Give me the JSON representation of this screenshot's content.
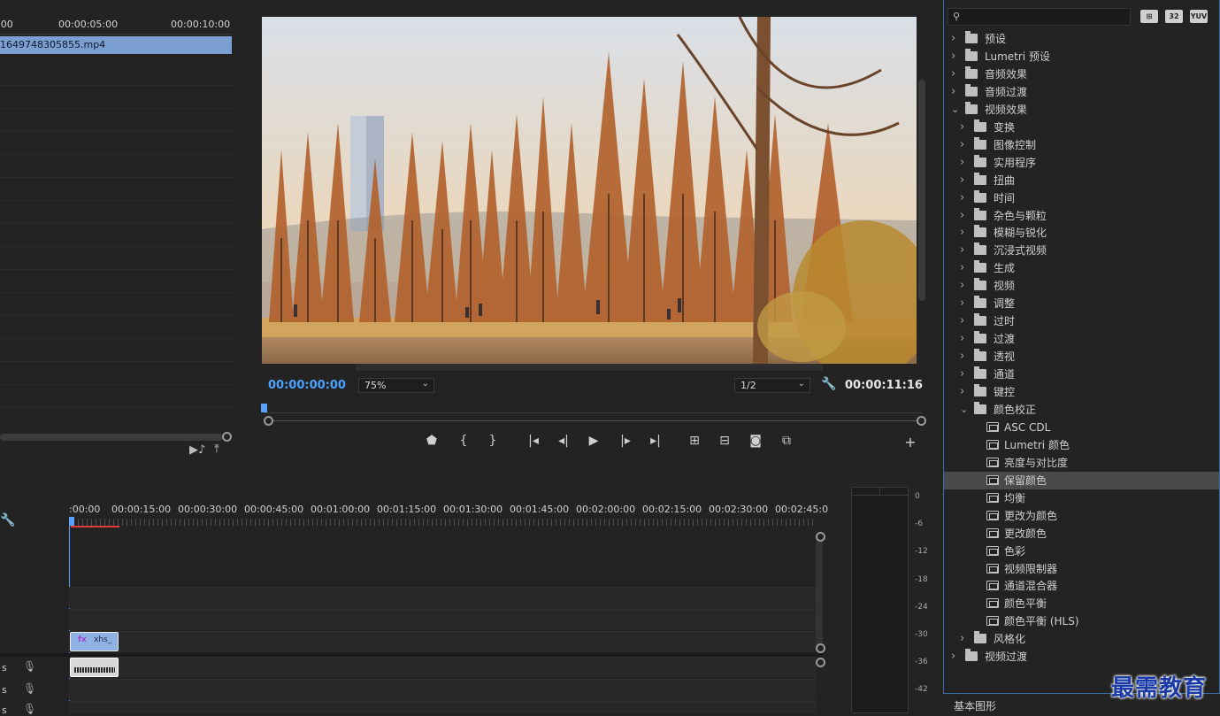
{
  "source": {
    "ruler_labels": [
      ":00",
      "00:00:05:00",
      "00:00:10:00"
    ],
    "clip_name": "1649748305855.mp4"
  },
  "program": {
    "current_time": "00:00:00:00",
    "zoom": "75%",
    "resolution": "1/2",
    "duration": "00:00:11:16",
    "playhead_fraction": 0
  },
  "timeline": {
    "ruler_labels": [
      ":00:00",
      "00:00:15:00",
      "00:00:30:00",
      "00:00:45:00",
      "00:01:00:00",
      "00:01:15:00",
      "00:01:30:00",
      "00:01:45:00",
      "00:02:00:00",
      "00:02:15:00",
      "00:02:30:00",
      "00:02:45:0"
    ],
    "video_clip_label": "xhs_",
    "video_clip_fx": "fx",
    "track_letters": [
      "s",
      "s",
      "s"
    ]
  },
  "meters": {
    "db_labels": [
      "0",
      "-6",
      "-12",
      "-18",
      "-24",
      "-30",
      "-36",
      "-42"
    ]
  },
  "effects": {
    "header_icons": [
      "32",
      "YUV"
    ],
    "items": [
      {
        "label": "预设",
        "level": 0,
        "type": "preset",
        "expanded": false
      },
      {
        "label": "Lumetri 预设",
        "level": 0,
        "type": "preset",
        "expanded": false
      },
      {
        "label": "音频效果",
        "level": 0,
        "type": "folder",
        "expanded": false
      },
      {
        "label": "音频过渡",
        "level": 0,
        "type": "folder",
        "expanded": false
      },
      {
        "label": "视频效果",
        "level": 0,
        "type": "folder",
        "expanded": true
      },
      {
        "label": "变换",
        "level": 1,
        "type": "folder",
        "expanded": false
      },
      {
        "label": "图像控制",
        "level": 1,
        "type": "folder",
        "expanded": false
      },
      {
        "label": "实用程序",
        "level": 1,
        "type": "folder",
        "expanded": false
      },
      {
        "label": "扭曲",
        "level": 1,
        "type": "folder",
        "expanded": false
      },
      {
        "label": "时间",
        "level": 1,
        "type": "folder",
        "expanded": false
      },
      {
        "label": "杂色与颗粒",
        "level": 1,
        "type": "folder",
        "expanded": false
      },
      {
        "label": "模糊与锐化",
        "level": 1,
        "type": "folder",
        "expanded": false
      },
      {
        "label": "沉浸式视频",
        "level": 1,
        "type": "folder",
        "expanded": false
      },
      {
        "label": "生成",
        "level": 1,
        "type": "folder",
        "expanded": false
      },
      {
        "label": "视频",
        "level": 1,
        "type": "folder",
        "expanded": false
      },
      {
        "label": "调整",
        "level": 1,
        "type": "folder",
        "expanded": false
      },
      {
        "label": "过时",
        "level": 1,
        "type": "folder",
        "expanded": false
      },
      {
        "label": "过渡",
        "level": 1,
        "type": "folder",
        "expanded": false
      },
      {
        "label": "透视",
        "level": 1,
        "type": "folder",
        "expanded": false
      },
      {
        "label": "通道",
        "level": 1,
        "type": "folder",
        "expanded": false
      },
      {
        "label": "键控",
        "level": 1,
        "type": "folder",
        "expanded": false
      },
      {
        "label": "颜色校正",
        "level": 1,
        "type": "folder",
        "expanded": true
      },
      {
        "label": "ASC CDL",
        "level": 2,
        "type": "effect"
      },
      {
        "label": "Lumetri 颜色",
        "level": 2,
        "type": "effect"
      },
      {
        "label": "亮度与对比度",
        "level": 2,
        "type": "effect"
      },
      {
        "label": "保留颜色",
        "level": 2,
        "type": "effect",
        "selected": true
      },
      {
        "label": "均衡",
        "level": 2,
        "type": "effect"
      },
      {
        "label": "更改为颜色",
        "level": 2,
        "type": "effect"
      },
      {
        "label": "更改颜色",
        "level": 2,
        "type": "effect"
      },
      {
        "label": "色彩",
        "level": 2,
        "type": "effect"
      },
      {
        "label": "视频限制器",
        "level": 2,
        "type": "effect"
      },
      {
        "label": "通道混合器",
        "level": 2,
        "type": "effect"
      },
      {
        "label": "颜色平衡",
        "level": 2,
        "type": "effect"
      },
      {
        "label": "颜色平衡 (HLS)",
        "level": 2,
        "type": "effect"
      },
      {
        "label": "风格化",
        "level": 1,
        "type": "folder",
        "expanded": false
      },
      {
        "label": "视频过渡",
        "level": 0,
        "type": "folder",
        "expanded": false
      }
    ]
  },
  "bottom_panel_title": "基本图形",
  "watermark": "最需教育",
  "colors": {
    "accent_blue": "#4aa3ff",
    "playhead_blue": "#5aa0ff",
    "clip_blue": "#7a9fd0",
    "work_area_red": "#e23a3a"
  }
}
